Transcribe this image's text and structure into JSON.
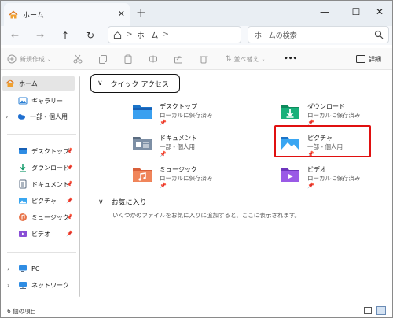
{
  "titlebar": {
    "tab_title": "ホーム",
    "close": "✕",
    "new_tab": "+",
    "minimize": "—",
    "maximize": "☐",
    "close_window": "✕"
  },
  "nav": {
    "back": "←",
    "forward": "→",
    "up": "↑",
    "refresh": "↻",
    "address": {
      "crumb_sep": ">",
      "crumb": "ホーム",
      "trail": ">"
    },
    "search_placeholder": "ホームの検索"
  },
  "commandbar": {
    "new_label": "新規作成",
    "sort_label": "並べ替え",
    "more": "•••",
    "details_label": "詳細"
  },
  "sidebar": {
    "items": [
      {
        "label": "ホーム",
        "icon": "home-icon",
        "selected": true
      },
      {
        "label": "ギャラリー",
        "icon": "gallery-icon"
      },
      {
        "label": "一部 - 個人用",
        "icon": "onedrive-icon",
        "expandable": true
      },
      {
        "label": "デスクトップ",
        "icon": "desktop-icon",
        "pinned": true
      },
      {
        "label": "ダウンロード",
        "icon": "download-icon",
        "pinned": true
      },
      {
        "label": "ドキュメント",
        "icon": "documents-icon",
        "pinned": true
      },
      {
        "label": "ピクチャ",
        "icon": "pictures-icon",
        "pinned": true
      },
      {
        "label": "ミュージック",
        "icon": "music-icon",
        "pinned": true
      },
      {
        "label": "ビデオ",
        "icon": "videos-icon",
        "pinned": true
      },
      {
        "label": "PC",
        "icon": "pc-icon",
        "expandable": true
      },
      {
        "label": "ネットワーク",
        "icon": "network-icon",
        "expandable": true
      }
    ]
  },
  "main": {
    "quick_access_header": "クイック アクセス",
    "quick_access": [
      {
        "name": "デスクトップ",
        "sub": "ローカルに保存済み",
        "icon": "desktop-folder-icon"
      },
      {
        "name": "ダウンロード",
        "sub": "ローカルに保存済み",
        "icon": "downloads-folder-icon"
      },
      {
        "name": "ドキュメント",
        "sub": "一部 - 個人用",
        "icon": "documents-folder-icon"
      },
      {
        "name": "ピクチャ",
        "sub": "一部 - 個人用",
        "icon": "pictures-folder-icon",
        "highlighted": true
      },
      {
        "name": "ミュージック",
        "sub": "ローカルに保存済み",
        "icon": "music-folder-icon"
      },
      {
        "name": "ビデオ",
        "sub": "ローカルに保存済み",
        "icon": "videos-folder-icon"
      }
    ],
    "favorites_header": "お気に入り",
    "favorites_desc": "いくつかのファイルをお気に入りに追加すると、ここに表示されます。"
  },
  "status": {
    "count": "6 個の項目"
  },
  "colors": {
    "highlight": "#e01010",
    "accent": "#0067c0",
    "selection": "#e5e5e5"
  }
}
